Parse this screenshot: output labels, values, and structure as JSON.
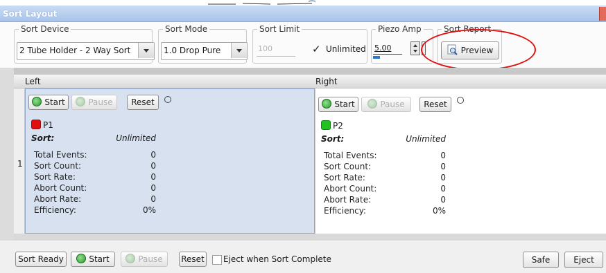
{
  "window": {
    "title": "Sort Layout"
  },
  "toolbar": {
    "sort_device": {
      "label": "Sort Device",
      "value": "2 Tube Holder - 2 Way Sort"
    },
    "sort_mode": {
      "label": "Sort Mode",
      "value": "1.0 Drop Pure"
    },
    "sort_limit": {
      "label": "Sort Limit",
      "value": "100",
      "unlimited_label": "Unlimited",
      "unlimited_checked": true
    },
    "piezo_amp": {
      "label": "Piezo Amp",
      "value": "5.00"
    },
    "sort_report": {
      "label": "Sort Report",
      "preview_label": "Preview"
    }
  },
  "grid": {
    "row_number": "1",
    "left": {
      "header": "Left",
      "start_label": "Start",
      "pause_label": "Pause",
      "reset_label": "Reset",
      "gate_name": "P1",
      "gate_color": "#e01010",
      "sort_label": "Sort:",
      "sort_value": "Unlimited",
      "stats": [
        {
          "label": "Total Events:",
          "value": "0"
        },
        {
          "label": "Sort Count:",
          "value": "0"
        },
        {
          "label": "Sort Rate:",
          "value": "0"
        },
        {
          "label": "Abort Count:",
          "value": "0"
        },
        {
          "label": "Abort Rate:",
          "value": "0"
        },
        {
          "label": "Efficiency:",
          "value": "0%"
        }
      ]
    },
    "right": {
      "header": "Right",
      "start_label": "Start",
      "pause_label": "Pause",
      "reset_label": "Reset",
      "gate_name": "P2",
      "gate_color": "#22c022",
      "sort_label": "Sort:",
      "sort_value": "Unlimited",
      "stats": [
        {
          "label": "Total Events:",
          "value": "0"
        },
        {
          "label": "Sort Count:",
          "value": "0"
        },
        {
          "label": "Sort Rate:",
          "value": "0"
        },
        {
          "label": "Abort Count:",
          "value": "0"
        },
        {
          "label": "Abort Rate:",
          "value": "0"
        },
        {
          "label": "Efficiency:",
          "value": "0%"
        }
      ]
    }
  },
  "bottom": {
    "sort_ready_label": "Sort Ready",
    "start_label": "Start",
    "pause_label": "Pause",
    "reset_label": "Reset",
    "eject_when_complete_label": "Eject when Sort Complete",
    "safe_label": "Safe",
    "eject_label": "Eject"
  },
  "colors": {
    "annotation": "#e01010",
    "title_bar": "#a9c4ea",
    "selected_pane": "#d7e1f0"
  }
}
